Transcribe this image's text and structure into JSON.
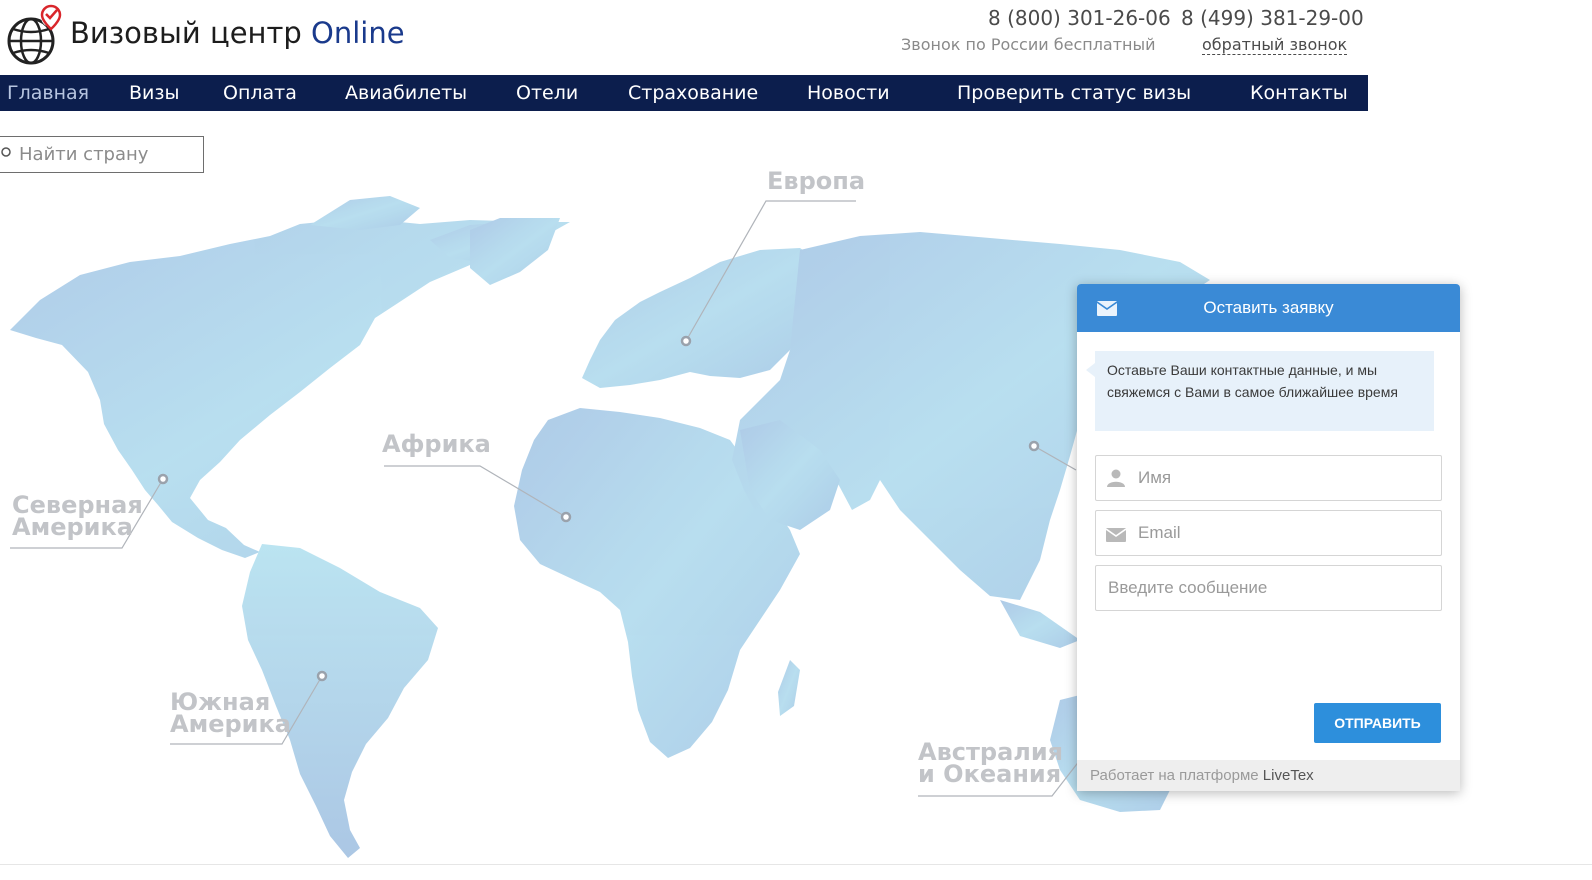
{
  "header": {
    "title_main": "Визовый центр",
    "title_accent": "Online",
    "phone_free": "8 (800) 301-26-06",
    "phone_moscow": "8 (499) 381-29-00",
    "free_call_note": "Звонок по России бесплатный",
    "callback_link": "обратный звонок"
  },
  "nav": {
    "items": [
      {
        "label": "Главная",
        "active": true
      },
      {
        "label": "Визы"
      },
      {
        "label": "Оплата"
      },
      {
        "label": "Авиабилеты"
      },
      {
        "label": "Отели"
      },
      {
        "label": "Страхование"
      },
      {
        "label": "Новости"
      },
      {
        "label": "Проверить статус визы"
      },
      {
        "label": "Контакты"
      }
    ]
  },
  "search": {
    "placeholder": "Найти страну",
    "value": ""
  },
  "map": {
    "regions": {
      "europe": "Европа",
      "africa": "Африка",
      "north_america_1": "Северная",
      "north_america_2": "Америка",
      "south_america_1": "Южная",
      "south_america_2": "Америка",
      "oceania_1": "Австралия",
      "oceania_2": "и Океания"
    }
  },
  "widget": {
    "title": "Оставить заявку",
    "message": "Оставьте Ваши контактные данные, и мы свяжемся с Вами в самое ближайшее время",
    "name_placeholder": "Имя",
    "email_placeholder": "Email",
    "message_placeholder": "Введите сообщение",
    "submit_label": "Отправить",
    "footer_text": "Работает на платформе",
    "footer_brand": "LiveTex"
  },
  "colors": {
    "nav_bg": "#0c1e4d",
    "accent_blue": "#3a8ad6",
    "button_blue": "#2d8fdc",
    "map_land": "#a9cce6",
    "region_label": "#c2c4c8"
  },
  "icons": [
    "globe-pin-logo-icon",
    "search-icon",
    "envelope-icon",
    "user-icon"
  ]
}
